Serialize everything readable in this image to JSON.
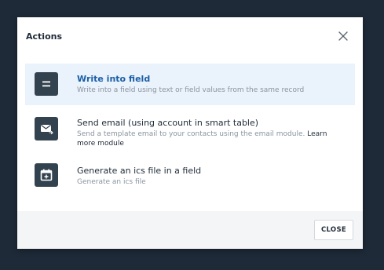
{
  "dialog": {
    "title": "Actions",
    "close_icon": "close-icon"
  },
  "actions": [
    {
      "label": "Write into field",
      "description": "Write into a field using text or field values from the same record",
      "icon": "equals-icon",
      "highlighted": true
    },
    {
      "label": "Send email (using account in smart table)",
      "description": "Send a template email to your contacts using the email module.",
      "link_text": "Learn more module",
      "icon": "email-send-icon",
      "highlighted": false
    },
    {
      "label": "Generate an ics file in a field",
      "description": "Generate an ics file",
      "icon": "calendar-add-icon",
      "highlighted": false
    }
  ],
  "footer": {
    "close_label": "CLOSE"
  },
  "colors": {
    "backdrop": "#1e2a38",
    "icon_tile": "#33424f",
    "highlight": "#eaf2fb",
    "active_label": "#1b5fa8"
  }
}
